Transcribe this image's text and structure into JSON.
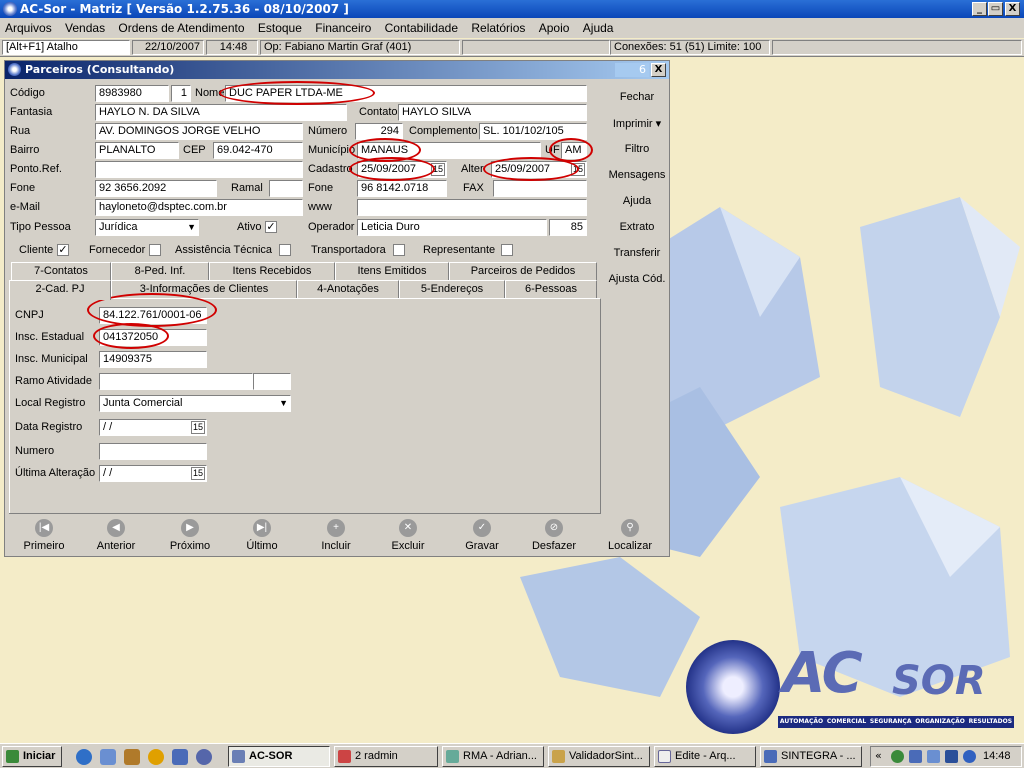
{
  "app": {
    "title": "AC-Sor - Matriz  [ Versão 1.2.75.36 - 08/10/2007 ]",
    "window_buttons": {
      "minimize": "_",
      "maximize": "▭",
      "close": "X"
    }
  },
  "menu": [
    "Arquivos",
    "Vendas",
    "Ordens de Atendimento",
    "Estoque",
    "Financeiro",
    "Contabilidade",
    "Relatórios",
    "Apoio",
    "Ajuda"
  ],
  "status": {
    "shortcut": "[Alt+F1] Atalho",
    "date": "22/10/2007",
    "time": "14:48",
    "operator": "Op: Fabiano Martin Graf (401)",
    "connections": "Conexões: 51 (51)  Limite: 100"
  },
  "window": {
    "title": "Parceiros (Consultando)",
    "badge": "6",
    "close": "X"
  },
  "form": {
    "codigo_label": "Código",
    "codigo": "8983980",
    "codigo_seq": "1",
    "nome_label": "Nome",
    "nome": "DUC PAPER LTDA-ME",
    "fantasia_label": "Fantasia",
    "fantasia": "HAYLO N. DA SILVA",
    "contato_label": "Contato",
    "contato": "HAYLO SILVA",
    "rua_label": "Rua",
    "rua": "AV. DOMINGOS JORGE VELHO",
    "numero_label": "Número",
    "numero": "294",
    "complemento_label": "Complemento",
    "complemento": "SL. 101/102/105",
    "bairro_label": "Bairro",
    "bairro": "PLANALTO",
    "cep_label": "CEP",
    "cep": "69.042-470",
    "municipio_label": "Município",
    "municipio": "MANAUS",
    "uf_label": "UF",
    "uf": "AM",
    "pontoref_label": "Ponto.Ref.",
    "pontoref": "",
    "cadastro_label": "Cadastro",
    "cadastro": "25/09/2007",
    "alter_label": "Alter",
    "alter": "25/09/2007",
    "fone_label": "Fone",
    "fone": "92 3656.2092",
    "ramal_label": "Ramal",
    "ramal": "",
    "fone2_label": "Fone",
    "fone2": "96 8142.0718",
    "fax_label": "FAX",
    "fax": "",
    "email_label": "e-Mail",
    "email": "hayloneto@dsptec.com.br",
    "www_label": "www",
    "www": "",
    "tipo_label": "Tipo Pessoa",
    "tipo": "Jurídica",
    "ativo_label": "Ativo",
    "operador_label": "Operador",
    "operador": "Leticia Duro",
    "operador_id": "85",
    "checks": {
      "cliente": "Cliente",
      "fornecedor": "Fornecedor",
      "assistencia": "Assistência Técnica",
      "transportadora": "Transportadora",
      "representante": "Representante"
    }
  },
  "tabs_row1": [
    "7-Contatos",
    "8-Ped. Inf.",
    "Itens Recebidos",
    "Itens Emitidos",
    "Parceiros de Pedidos"
  ],
  "tabs_row2": [
    "2-Cad. PJ",
    "3-Informações de Clientes",
    "4-Anotações",
    "5-Endereços",
    "6-Pessoas"
  ],
  "pj": {
    "cnpj_label": "CNPJ",
    "cnpj": "84.122.761/0001-06",
    "ie_label": "Insc. Estadual",
    "ie": "041372050",
    "im_label": "Insc. Municipal",
    "im": "14909375",
    "ramo_label": "Ramo Atividade",
    "ramo": "",
    "local_label": "Local Registro",
    "local": "Junta Comercial",
    "data_label": "Data Registro",
    "data": " /  /",
    "numero_label": "Numero",
    "numero": "",
    "ultima_label": "Última Alteração",
    "ultima": " /  /"
  },
  "side_buttons": [
    "Fechar",
    "Imprimir ▾",
    "Filtro",
    "Mensagens",
    "Ajuda",
    "Extrato",
    "Transferir",
    "Ajusta Cód."
  ],
  "nav_buttons": [
    "Primeiro",
    "Anterior",
    "Próximo",
    "Último",
    "Incluir",
    "Excluir",
    "Gravar",
    "Desfazer",
    "Localizar"
  ],
  "logo": {
    "text_ac": "AC",
    "text_sor": "SOR",
    "tagline": [
      "AUTOMAÇÃO",
      "COMERCIAL",
      "SEGURANÇA",
      "ORGANIZAÇÃO",
      "RESULTADOS"
    ]
  },
  "taskbar": {
    "start": "Iniciar",
    "items": [
      "AC-SOR",
      "2 radmin",
      "RMA - Adrian...",
      "ValidadorSint...",
      "Edite  - Arq...",
      "SINTEGRA - ..."
    ],
    "clock": "14:48"
  }
}
